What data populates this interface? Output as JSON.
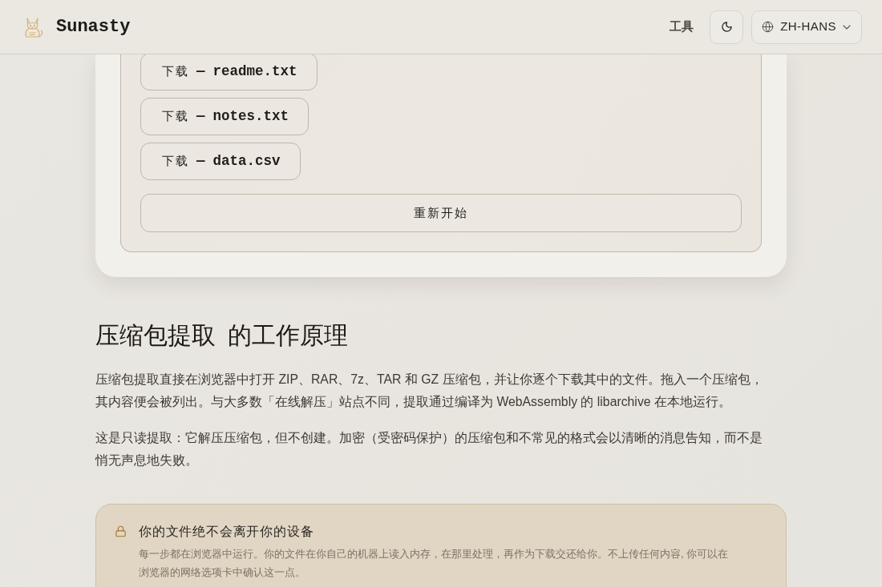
{
  "header": {
    "brand": "Sunasty",
    "nav": [
      {
        "label": "工具"
      }
    ],
    "language": {
      "label": "ZH-HANS"
    }
  },
  "extractor": {
    "downloads": [
      {
        "action": "下载",
        "separator": "—",
        "filename": "readme.txt"
      },
      {
        "action": "下载",
        "separator": "—",
        "filename": "notes.txt"
      },
      {
        "action": "下载",
        "separator": "—",
        "filename": "data.csv"
      }
    ],
    "restart": "重新开始"
  },
  "article": {
    "heading": "压缩包提取  的工作原理",
    "paragraphs": [
      {
        "lines": [
          "压缩包提取直接在浏览器中打开 ZIP、RAR、7z、TAR 和 GZ 压缩包，并让你逐个下载其中的文件。拖入一个压缩包，",
          "其内容便会被列出。与大多数「在线解压」站点不同，提取通过编译为 WebAssembly 的 libarchive 在本地运行。"
        ]
      },
      {
        "lines": [
          "这是只读提取：它解压压缩包，但不创建。加密（受密码保护）的压缩包和不常见的格式会以清晰的消息告知，而不是",
          "悄无声息地失败。"
        ]
      }
    ]
  },
  "privacy_note": {
    "title": "你的文件绝不会离开你的设备",
    "lines": [
      "每一步都在浏览器中运行。你的文件在你自己的机器上读入内存，在那里处理，再作为下载交还给你。不上传任何内容, 你可以在",
      "浏览器的网络选项卡中确认这一点。"
    ]
  }
}
